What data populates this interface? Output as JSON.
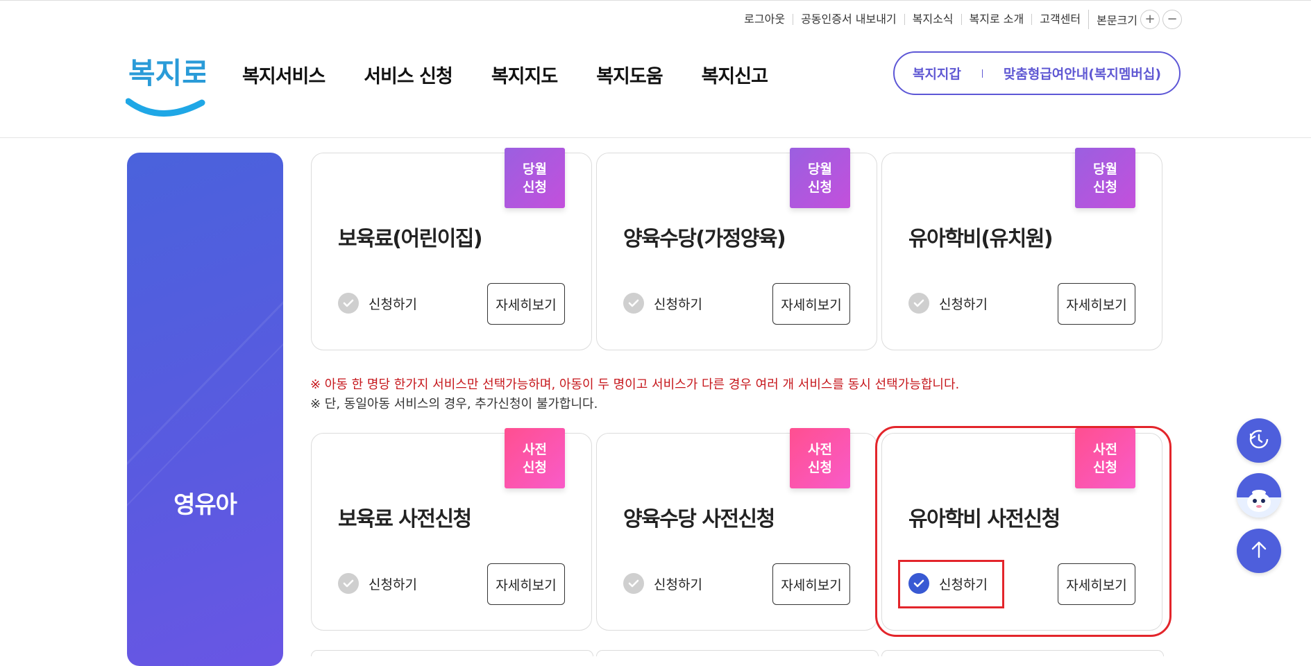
{
  "utility_nav": {
    "items": [
      "로그아웃",
      "공동인증서 내보내기",
      "복지소식",
      "복지로 소개",
      "고객센터"
    ],
    "font_size_label": "본문크기",
    "plus": "+",
    "minus": "−"
  },
  "logo": {
    "text": "복지로"
  },
  "gnb": {
    "items": [
      "복지서비스",
      "서비스 신청",
      "복지지도",
      "복지도움",
      "복지신고"
    ]
  },
  "header_pill": {
    "left": "복지지갑",
    "right": "맞춤형급여안내(복지멤버십)"
  },
  "sidebar": {
    "label": "영유아"
  },
  "cards_row1": [
    {
      "badge": "당월 신청",
      "title": "보육료(어린이집)",
      "apply": "신청하기",
      "detail": "자세히보기",
      "checked": false
    },
    {
      "badge": "당월 신청",
      "title": "양육수당(가정양육)",
      "apply": "신청하기",
      "detail": "자세히보기",
      "checked": false
    },
    {
      "badge": "당월 신청",
      "title": "유아학비(유치원)",
      "apply": "신청하기",
      "detail": "자세히보기",
      "checked": false
    }
  ],
  "notice": {
    "line1": "※ 아동 한 명당 한가지 서비스만 선택가능하며, 아동이 두 명이고 서비스가 다른 경우 여러 개 서비스를 동시 선택가능합니다.",
    "line2": "※ 단, 동일아동 서비스의 경우, 추가신청이 불가합니다."
  },
  "cards_row2": [
    {
      "badge": "사전 신청",
      "title": "보육료 사전신청",
      "apply": "신청하기",
      "detail": "자세히보기",
      "checked": false
    },
    {
      "badge": "사전 신청",
      "title": "양육수당 사전신청",
      "apply": "신청하기",
      "detail": "자세히보기",
      "checked": false
    },
    {
      "badge": "사전 신청",
      "title": "유아학비 사전신청",
      "apply": "신청하기",
      "detail": "자세히보기",
      "checked": true
    }
  ],
  "colors": {
    "accent": "#5f58d3",
    "sidebar": "#5a5ae0",
    "badge_purple": "#b158dd",
    "badge_pink": "#fc55a8",
    "highlight": "#e3252b",
    "notice_red": "#c6171c",
    "checked": "#3859d3"
  },
  "floating_buttons": [
    "history-icon",
    "chatbot-mascot-icon",
    "arrow-up-icon"
  ]
}
